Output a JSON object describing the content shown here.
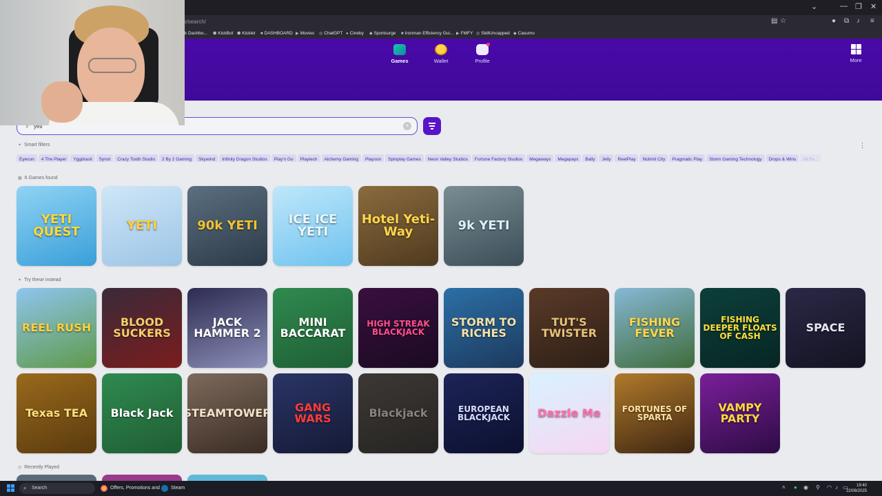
{
  "browser": {
    "url": "es/search/",
    "bookmarks": [
      "k Dashbo...",
      "KickBot",
      "Kicklet",
      "DASHBOARD",
      "Movies",
      "ChatGPT",
      "Cineby",
      "Sportsurge",
      "Ironman Efficiency Gui...",
      "FMFY",
      "SkillUncapped",
      "Casumo"
    ],
    "window_controls": {
      "minimize": "—",
      "restore": "❐",
      "close": "✕",
      "tabs_menu": "⌄"
    }
  },
  "nav": {
    "games": "Games",
    "wallet": "Wallet",
    "profile": "Profile",
    "more": "More"
  },
  "search": {
    "value": "yeti",
    "clear": "×",
    "icon": "search-icon"
  },
  "smart_filters": {
    "label": "Smart filters",
    "menu": "⋮",
    "chips": [
      "Eyecon",
      "4 The Player",
      "Yggdrasil",
      "Synot",
      "Crazy Tooth Studio",
      "2 By 2 Gaming",
      "Skywind",
      "Infinity Dragon Studios",
      "Play'n Go",
      "Playtech",
      "Alchemy Gaming",
      "Playson",
      "Spinplay Games",
      "Neon Valley Studios",
      "Fortune Factory Studios",
      "Megaways",
      "Megapays",
      "Bally",
      "Jelly",
      "ReelPlay",
      "Nolimit City",
      "Pragmatic Play",
      "Storm Gaming Technology",
      "Drops & Wins",
      "All Fe..."
    ]
  },
  "results": {
    "count_label": "6 Games found",
    "games": [
      {
        "title": "YETI QUEST",
        "colors": [
          "#8fd3f4",
          "#3a9fd8"
        ],
        "text_color": "#ffd93b"
      },
      {
        "title": "YETI",
        "colors": [
          "#cfe6f7",
          "#9cc5e6"
        ],
        "text_color": "#ffcf3a"
      },
      {
        "title": "90k YETI",
        "colors": [
          "#5b6f80",
          "#2c3a48"
        ],
        "text_color": "#f2c230"
      },
      {
        "title": "ICE ICE YETI",
        "colors": [
          "#bfe7fb",
          "#6fc3ee"
        ],
        "text_color": "#e9f7ff"
      },
      {
        "title": "Hotel Yeti-Way",
        "colors": [
          "#8b6b3e",
          "#4f3a1f"
        ],
        "text_color": "#ffd64a"
      },
      {
        "title": "9k YETI",
        "colors": [
          "#7a8d93",
          "#3b4d57"
        ],
        "text_color": "#d8f0ff"
      }
    ]
  },
  "try_instead": {
    "label": "Try these instead",
    "games_row1": [
      {
        "title": "REEL RUSH",
        "colors": [
          "#8ec5ef",
          "#5f9a4a"
        ],
        "text_color": "#ffd23a"
      },
      {
        "title": "BLOOD SUCKERS",
        "colors": [
          "#3a2a3a",
          "#7a1d1d"
        ],
        "text_color": "#f4d06a"
      },
      {
        "title": "JACK HAMMER 2",
        "colors": [
          "#2d2b52",
          "#8b8fb8"
        ],
        "text_color": "#ffffff"
      },
      {
        "title": "MINI BACCARAT",
        "colors": [
          "#2f8a4f",
          "#1f5e35"
        ],
        "text_color": "#ffffff"
      },
      {
        "title": "HIGH STREAK BLACKJACK",
        "colors": [
          "#3a0f3f",
          "#1a0a22"
        ],
        "text_color": "#ff4f8a"
      },
      {
        "title": "STORM TO RICHES",
        "colors": [
          "#2c6fa6",
          "#1c3a5e"
        ],
        "text_color": "#f6e1a8"
      },
      {
        "title": "TUT'S TWISTER",
        "colors": [
          "#5a3a28",
          "#2e1f16"
        ],
        "text_color": "#e8c27a"
      },
      {
        "title": "FISHING FEVER",
        "colors": [
          "#86b8d6",
          "#3f6c3a"
        ],
        "text_color": "#ffd84a"
      },
      {
        "title": "FISHING DEEPER FLOATS OF CASH",
        "colors": [
          "#0d3f3a",
          "#072624"
        ],
        "text_color": "#ffdf3a"
      },
      {
        "title": "SPACE",
        "colors": [
          "#2b2846",
          "#141322"
        ],
        "text_color": "#e6e6f5"
      }
    ],
    "games_row2": [
      {
        "title": "Texas TEA",
        "colors": [
          "#9a6a1c",
          "#5a3a0e"
        ],
        "text_color": "#ffe07a"
      },
      {
        "title": "Black Jack",
        "colors": [
          "#2f8a4f",
          "#1f5e35"
        ],
        "text_color": "#ffffff"
      },
      {
        "title": "STEAMTOWER",
        "colors": [
          "#7d6a5c",
          "#3a2c24"
        ],
        "text_color": "#f3e2c8"
      },
      {
        "title": "GANG WARS",
        "colors": [
          "#2a3566",
          "#151a36"
        ],
        "text_color": "#ff3b3b"
      },
      {
        "title": "Blackjack",
        "colors": [
          "#3c3835",
          "#262422"
        ],
        "text_color": "#8a837c"
      },
      {
        "title": "EUROPEAN BLACKJACK",
        "colors": [
          "#1d2457",
          "#0c1030"
        ],
        "text_color": "#d8dcff"
      },
      {
        "title": "Dazzle Me",
        "colors": [
          "#d8f2ff",
          "#f6d7f2"
        ],
        "text_color": "#ff6fb0"
      },
      {
        "title": "FORTUNES OF SPARTA",
        "colors": [
          "#b07a2a",
          "#3e2612"
        ],
        "text_color": "#ffe2a0"
      },
      {
        "title": "VAMPY PARTY",
        "colors": [
          "#7a1f9a",
          "#2d0c44"
        ],
        "text_color": "#ffd93b"
      }
    ]
  },
  "recently_played": {
    "label": "Recently Played"
  },
  "taskbar": {
    "search": "Search",
    "task1": "Offers, Promotions and",
    "task2": "Steam",
    "time": "19:40",
    "date": "22/08/2025"
  },
  "accent": "#5a14c8"
}
